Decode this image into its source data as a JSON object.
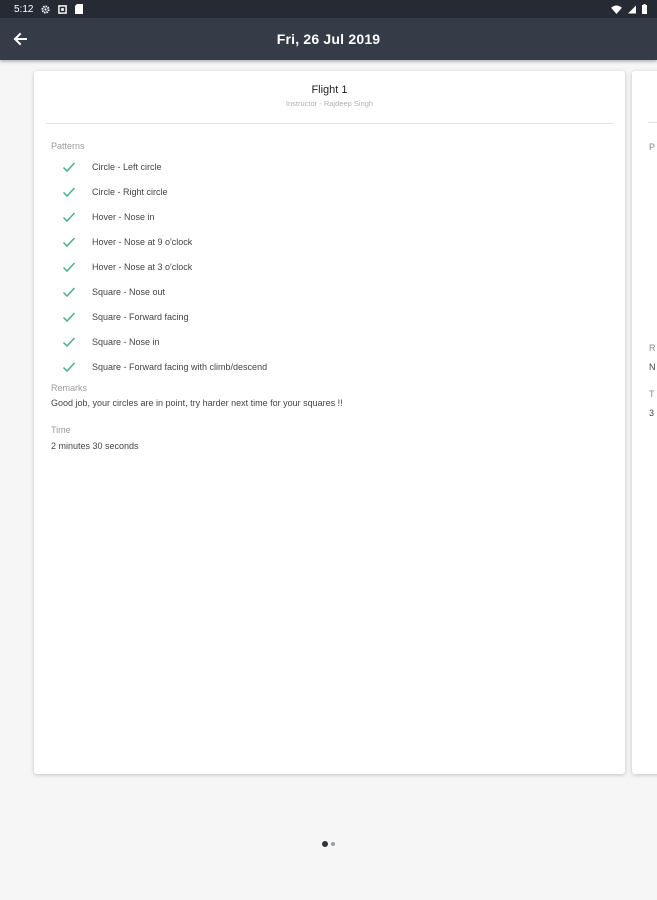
{
  "status_bar": {
    "time": "5:12",
    "left_icons": [
      "gear-icon",
      "square-icon",
      "sd-card-icon"
    ],
    "right_icons": [
      "wifi-icon",
      "signal-icon",
      "battery-icon"
    ]
  },
  "app_bar": {
    "title": "Fri, 26 Jul 2019",
    "back_icon": "arrow-left-icon",
    "background": "#363b48"
  },
  "flight_card": {
    "title": "Flight 1",
    "subtitle": "Instructor - Rajdeep Singh",
    "patterns_label": "Patterns",
    "check_color": "#4caf8a",
    "patterns": [
      "Circle - Left circle",
      "Circle - Right circle",
      "Hover - Nose in",
      "Hover - Nose at 9 o'clock",
      "Hover - Nose at 3 o'clock",
      "Square - Nose out",
      "Square - Forward facing",
      "Square - Nose in",
      "Square - Forward facing with climb/descend"
    ],
    "remarks_label": "Remarks",
    "remarks": "Good job, your circles are in point, try harder next time for your squares !!",
    "time_label": "Time",
    "time": "2 minutes 30 seconds"
  },
  "next_card_peek": {
    "patterns_initial": "P",
    "remarks_initial": "R",
    "remarks_value_initial": "N",
    "time_initial": "T",
    "time_value_initial": "3"
  },
  "pager": {
    "total": 2,
    "current": 1
  }
}
